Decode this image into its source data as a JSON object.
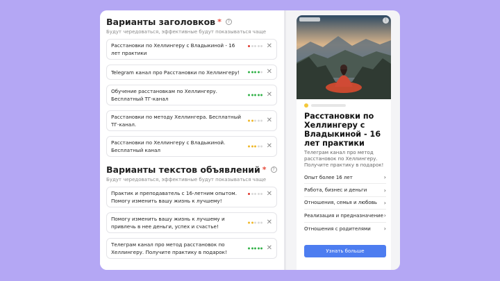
{
  "headlines": {
    "title": "Варианты заголовков",
    "required_mark": "*",
    "subtitle": "Будут чередоваться, эффективные будут показываться чаще",
    "items": [
      {
        "text": "Расстановки по Хеллингеру с Владыкиной - 16 лет практики",
        "rating": 1,
        "color": "#e03a2f"
      },
      {
        "text": "Telegram канал про Расстановки по Хеллингеру!",
        "rating": 4,
        "color": "#34b24a"
      },
      {
        "text": "Обучение расстановкам по Хеллингеру. Бесплатный ТГ-канал",
        "rating": 5,
        "color": "#34b24a"
      },
      {
        "text": "Расстановки по методу Хеллингера. Бесплатный ТГ-канал.",
        "rating": 2,
        "color": "#f0b82a"
      },
      {
        "text": "Расстановки по Хеллингеру с Владыкиной. Бесплатный канал",
        "rating": 3,
        "color": "#f0b82a"
      }
    ]
  },
  "texts": {
    "title": "Варианты текстов объявлений",
    "required_mark": "*",
    "subtitle": "Будут чередоваться, эффективные будут показываться чаще",
    "items": [
      {
        "text": "Практик и преподаватель с 16-летним опытом. Помогу изменить вашу жизнь к лучшему!",
        "rating": 1,
        "color": "#e03a2f"
      },
      {
        "text": "Помогу изменить вашу жизнь к лучшему и привлечь в нее деньги, успех и счастье!",
        "rating": 2,
        "color": "#f0b82a"
      },
      {
        "text": "Телеграм канал про метод расстановок по Хеллингеру. Получите практику в подарок!",
        "rating": 5,
        "color": "#34b24a"
      }
    ]
  },
  "preview": {
    "title": "Расстановки по Хеллингеру с Владыкиной - 16 лет практики",
    "text": "Телеграм канал про метод расстановок по Хеллингеру. Получите практику в подарок!",
    "links": [
      "Опыт более 16 лет",
      "Работа, бизнес и деньги",
      "Отношения, семья и любовь",
      "Реализация и предназначение",
      "Отношения с родителями"
    ],
    "button": "Узнать больше"
  }
}
